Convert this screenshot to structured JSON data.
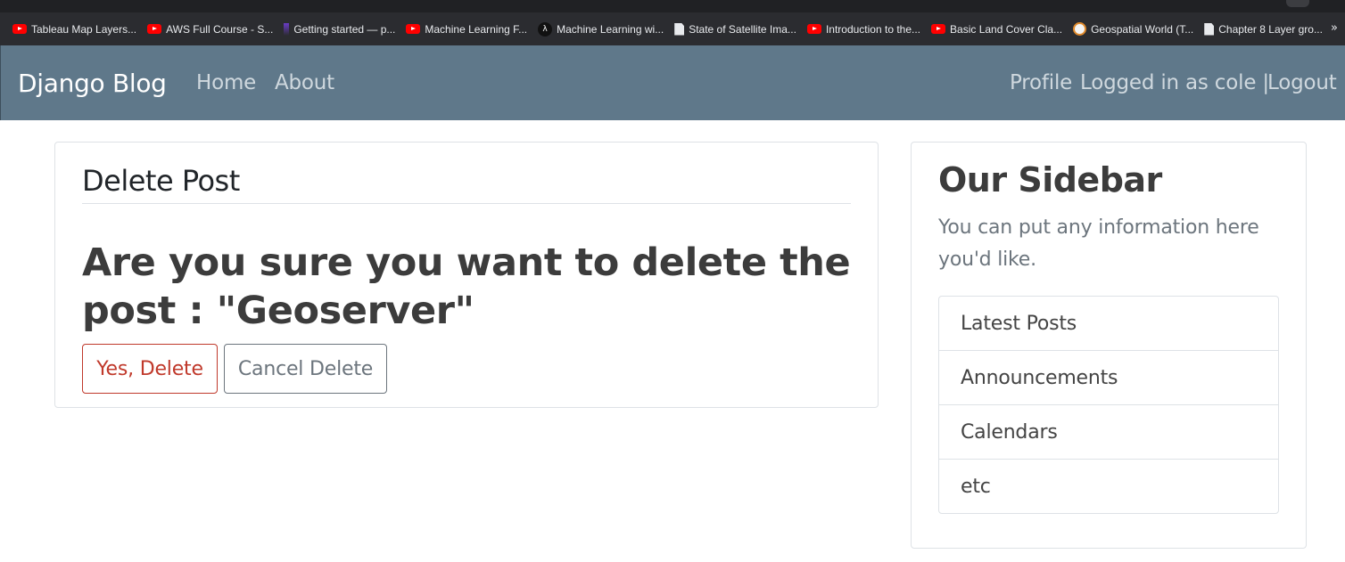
{
  "bookmarks": [
    {
      "label": "Tableau Map Layers...",
      "icon": "youtube-icon"
    },
    {
      "label": "AWS Full Course - S...",
      "icon": "youtube-icon"
    },
    {
      "label": "Getting started — p...",
      "icon": "site-icon"
    },
    {
      "label": "Machine Learning F...",
      "icon": "youtube-icon"
    },
    {
      "label": "Machine Learning wi...",
      "icon": "lambda-icon"
    },
    {
      "label": "State of Satellite Ima...",
      "icon": "document-icon"
    },
    {
      "label": "Introduction to the...",
      "icon": "youtube-icon"
    },
    {
      "label": "Basic Land Cover Cla...",
      "icon": "youtube-icon"
    },
    {
      "label": "Geospatial World (T...",
      "icon": "globe-icon"
    },
    {
      "label": "Chapter 8 Layer gro...",
      "icon": "document-icon"
    }
  ],
  "bookmarks_more": "»",
  "navbar": {
    "brand": "Django Blog",
    "left_links": [
      "Home",
      "About"
    ],
    "right_links": [
      "Profile",
      "Logged in as cole |",
      "Logout"
    ]
  },
  "main": {
    "legend": "Delete Post",
    "question": "Are you sure you want to delete the post : \"Geoserver\"",
    "confirm_label": "Yes, Delete",
    "cancel_label": "Cancel Delete"
  },
  "sidebar": {
    "title": "Our Sidebar",
    "text": "You can put any information here you'd like.",
    "items": [
      "Latest Posts",
      "Announcements",
      "Calendars",
      "etc"
    ]
  },
  "colors": {
    "navbar_bg": "#5f788a",
    "danger": "#c0392b",
    "secondary": "#6c757d"
  }
}
